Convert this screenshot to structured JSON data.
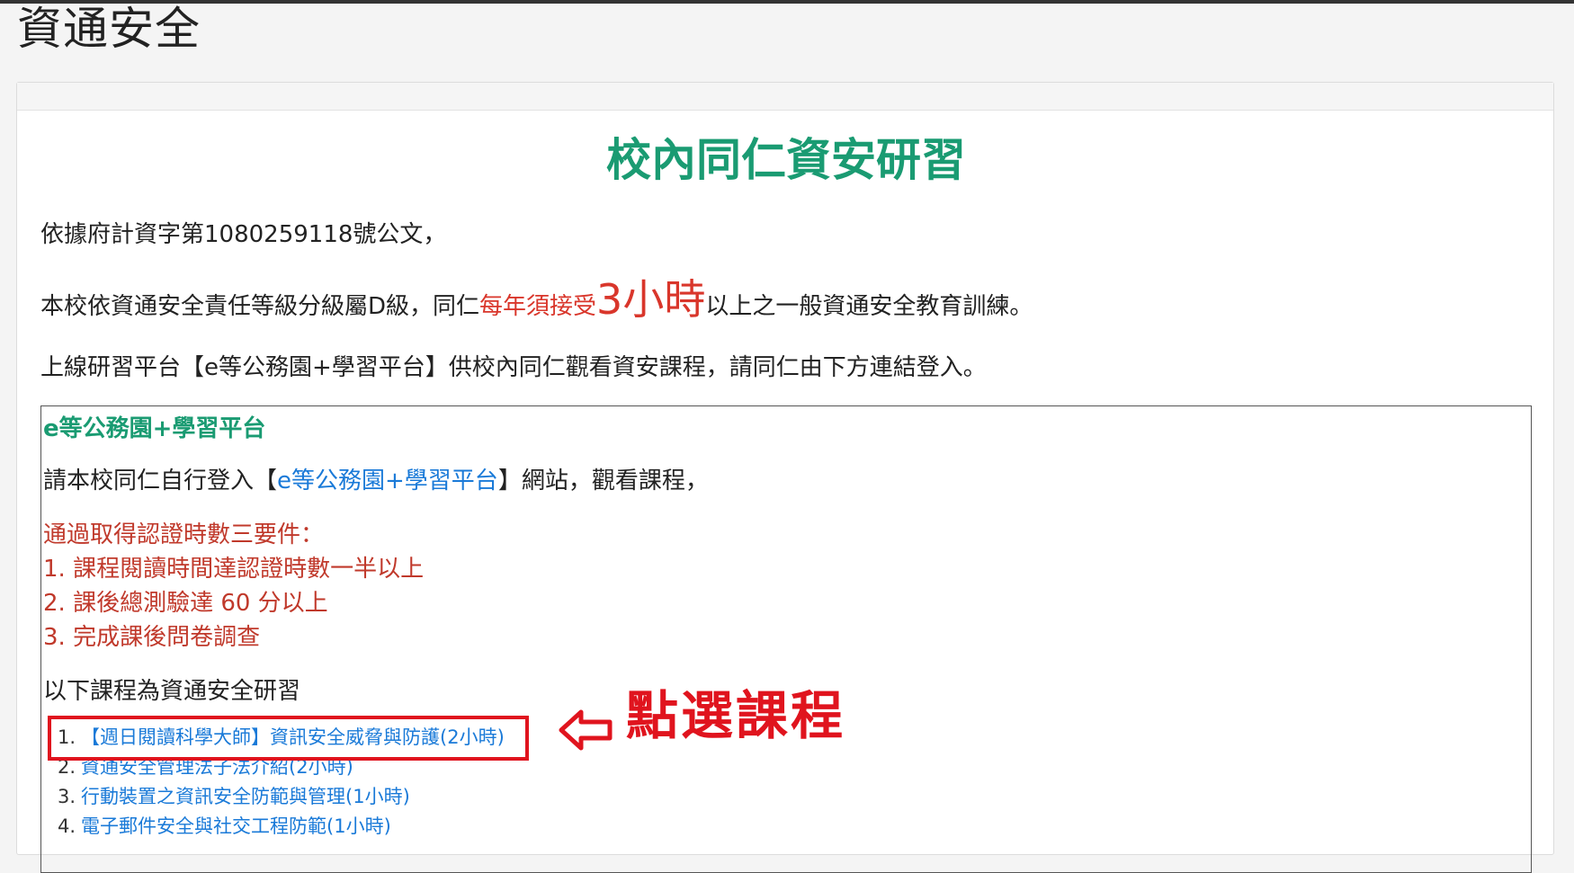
{
  "page": {
    "title": "資通安全"
  },
  "content": {
    "heading": "校內同仁資安研習",
    "p1": "依據府計資字第1080259118號公文，",
    "p2": {
      "pre": "本校依資通安全責任等級分級屬D級，同仁",
      "red": "每年須接受",
      "big": "3小時",
      "post": "以上之一般資通安全教育訓練。"
    },
    "p3": "上線研習平台【e等公務園+學習平台】供校內同仁觀看資安課程，請同仁由下方連結登入。"
  },
  "box": {
    "title": "e等公務園+學習平台",
    "line1": {
      "pre": "請本校同仁自行登入【",
      "link": "e等公務園+學習平台",
      "post": "】網站，觀看課程，"
    },
    "requirements_title": "通過取得認證時數三要件：",
    "requirements": [
      "1. 課程閱讀時間達認證時數一半以上",
      "2. 課後總測驗達 60 分以上",
      "3. 完成課後問卷調查"
    ],
    "courses_intro": "以下課程為資通安全研習",
    "courses": [
      {
        "num": "1.",
        "title": "【週日閱讀科學大師】資訊安全威脅與防護(2小時)"
      },
      {
        "num": "2.",
        "title": "資通安全管理法子法介紹(2小時)"
      },
      {
        "num": "3.",
        "title": "行動裝置之資訊安全防範與管理(1小時)"
      },
      {
        "num": "4.",
        "title": "電子郵件安全與社交工程防範(1小時)"
      }
    ]
  },
  "annotation": {
    "text": "點選課程",
    "icon": "arrow-left-outline-icon",
    "color": "#e0141e"
  }
}
